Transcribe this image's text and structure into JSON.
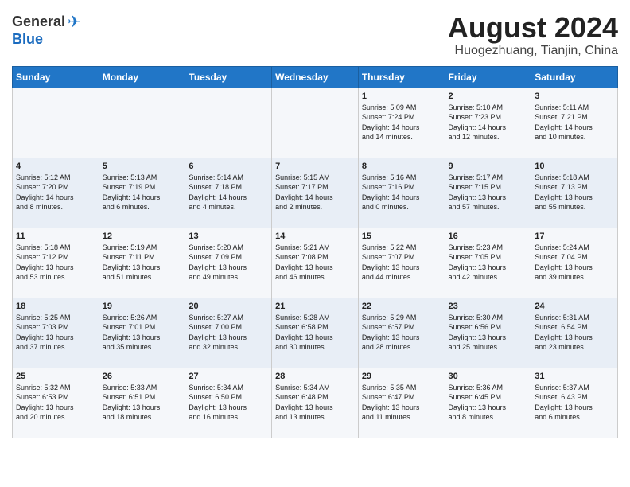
{
  "header": {
    "logo_general": "General",
    "logo_blue": "Blue",
    "month_year": "August 2024",
    "location": "Huogezhuang, Tianjin, China"
  },
  "weekdays": [
    "Sunday",
    "Monday",
    "Tuesday",
    "Wednesday",
    "Thursday",
    "Friday",
    "Saturday"
  ],
  "weeks": [
    [
      {
        "day": "",
        "info": ""
      },
      {
        "day": "",
        "info": ""
      },
      {
        "day": "",
        "info": ""
      },
      {
        "day": "",
        "info": ""
      },
      {
        "day": "1",
        "info": "Sunrise: 5:09 AM\nSunset: 7:24 PM\nDaylight: 14 hours\nand 14 minutes."
      },
      {
        "day": "2",
        "info": "Sunrise: 5:10 AM\nSunset: 7:23 PM\nDaylight: 14 hours\nand 12 minutes."
      },
      {
        "day": "3",
        "info": "Sunrise: 5:11 AM\nSunset: 7:21 PM\nDaylight: 14 hours\nand 10 minutes."
      }
    ],
    [
      {
        "day": "4",
        "info": "Sunrise: 5:12 AM\nSunset: 7:20 PM\nDaylight: 14 hours\nand 8 minutes."
      },
      {
        "day": "5",
        "info": "Sunrise: 5:13 AM\nSunset: 7:19 PM\nDaylight: 14 hours\nand 6 minutes."
      },
      {
        "day": "6",
        "info": "Sunrise: 5:14 AM\nSunset: 7:18 PM\nDaylight: 14 hours\nand 4 minutes."
      },
      {
        "day": "7",
        "info": "Sunrise: 5:15 AM\nSunset: 7:17 PM\nDaylight: 14 hours\nand 2 minutes."
      },
      {
        "day": "8",
        "info": "Sunrise: 5:16 AM\nSunset: 7:16 PM\nDaylight: 14 hours\nand 0 minutes."
      },
      {
        "day": "9",
        "info": "Sunrise: 5:17 AM\nSunset: 7:15 PM\nDaylight: 13 hours\nand 57 minutes."
      },
      {
        "day": "10",
        "info": "Sunrise: 5:18 AM\nSunset: 7:13 PM\nDaylight: 13 hours\nand 55 minutes."
      }
    ],
    [
      {
        "day": "11",
        "info": "Sunrise: 5:18 AM\nSunset: 7:12 PM\nDaylight: 13 hours\nand 53 minutes."
      },
      {
        "day": "12",
        "info": "Sunrise: 5:19 AM\nSunset: 7:11 PM\nDaylight: 13 hours\nand 51 minutes."
      },
      {
        "day": "13",
        "info": "Sunrise: 5:20 AM\nSunset: 7:09 PM\nDaylight: 13 hours\nand 49 minutes."
      },
      {
        "day": "14",
        "info": "Sunrise: 5:21 AM\nSunset: 7:08 PM\nDaylight: 13 hours\nand 46 minutes."
      },
      {
        "day": "15",
        "info": "Sunrise: 5:22 AM\nSunset: 7:07 PM\nDaylight: 13 hours\nand 44 minutes."
      },
      {
        "day": "16",
        "info": "Sunrise: 5:23 AM\nSunset: 7:05 PM\nDaylight: 13 hours\nand 42 minutes."
      },
      {
        "day": "17",
        "info": "Sunrise: 5:24 AM\nSunset: 7:04 PM\nDaylight: 13 hours\nand 39 minutes."
      }
    ],
    [
      {
        "day": "18",
        "info": "Sunrise: 5:25 AM\nSunset: 7:03 PM\nDaylight: 13 hours\nand 37 minutes."
      },
      {
        "day": "19",
        "info": "Sunrise: 5:26 AM\nSunset: 7:01 PM\nDaylight: 13 hours\nand 35 minutes."
      },
      {
        "day": "20",
        "info": "Sunrise: 5:27 AM\nSunset: 7:00 PM\nDaylight: 13 hours\nand 32 minutes."
      },
      {
        "day": "21",
        "info": "Sunrise: 5:28 AM\nSunset: 6:58 PM\nDaylight: 13 hours\nand 30 minutes."
      },
      {
        "day": "22",
        "info": "Sunrise: 5:29 AM\nSunset: 6:57 PM\nDaylight: 13 hours\nand 28 minutes."
      },
      {
        "day": "23",
        "info": "Sunrise: 5:30 AM\nSunset: 6:56 PM\nDaylight: 13 hours\nand 25 minutes."
      },
      {
        "day": "24",
        "info": "Sunrise: 5:31 AM\nSunset: 6:54 PM\nDaylight: 13 hours\nand 23 minutes."
      }
    ],
    [
      {
        "day": "25",
        "info": "Sunrise: 5:32 AM\nSunset: 6:53 PM\nDaylight: 13 hours\nand 20 minutes."
      },
      {
        "day": "26",
        "info": "Sunrise: 5:33 AM\nSunset: 6:51 PM\nDaylight: 13 hours\nand 18 minutes."
      },
      {
        "day": "27",
        "info": "Sunrise: 5:34 AM\nSunset: 6:50 PM\nDaylight: 13 hours\nand 16 minutes."
      },
      {
        "day": "28",
        "info": "Sunrise: 5:34 AM\nSunset: 6:48 PM\nDaylight: 13 hours\nand 13 minutes."
      },
      {
        "day": "29",
        "info": "Sunrise: 5:35 AM\nSunset: 6:47 PM\nDaylight: 13 hours\nand 11 minutes."
      },
      {
        "day": "30",
        "info": "Sunrise: 5:36 AM\nSunset: 6:45 PM\nDaylight: 13 hours\nand 8 minutes."
      },
      {
        "day": "31",
        "info": "Sunrise: 5:37 AM\nSunset: 6:43 PM\nDaylight: 13 hours\nand 6 minutes."
      }
    ]
  ]
}
